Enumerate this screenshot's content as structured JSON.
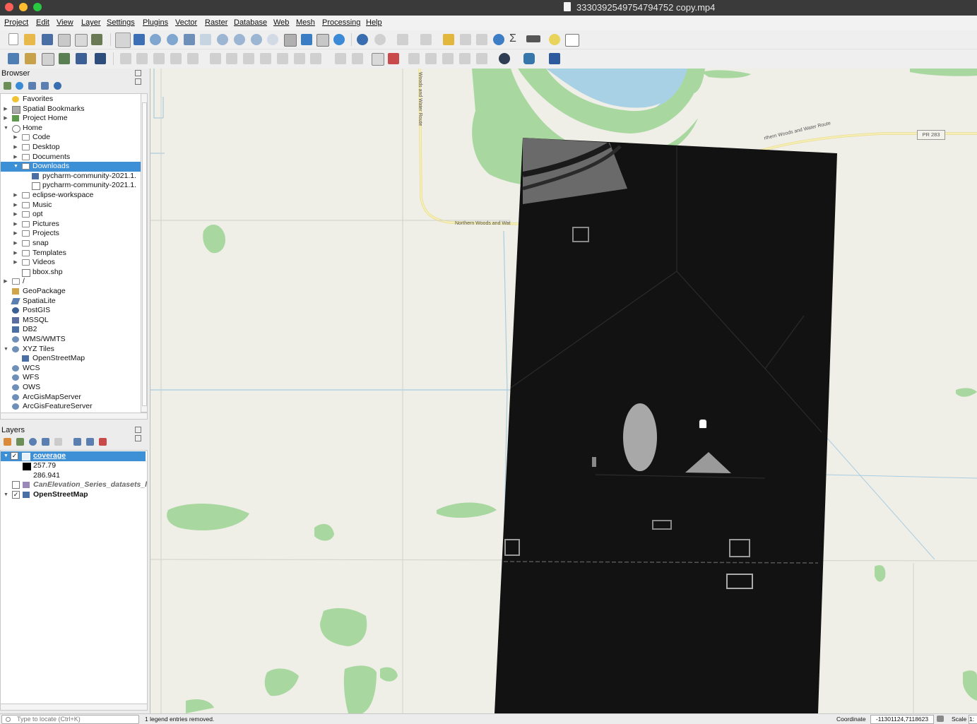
{
  "window": {
    "title": "3330392549754794752 copy.mp4"
  },
  "menubar": [
    "Project",
    "Edit",
    "View",
    "Layer",
    "Settings",
    "Plugins",
    "Vector",
    "Raster",
    "Database",
    "Web",
    "Mesh",
    "Processing",
    "Help"
  ],
  "browser": {
    "title": "Browser",
    "items": [
      {
        "label": "Favorites",
        "icon": "star-icon",
        "level": 0,
        "arrow": ""
      },
      {
        "label": "Spatial Bookmarks",
        "icon": "bookmarks-icon",
        "level": 0,
        "arrow": "right"
      },
      {
        "label": "Project Home",
        "icon": "project-home-icon",
        "level": 0,
        "arrow": "right"
      },
      {
        "label": "Home",
        "icon": "home-icon",
        "level": 0,
        "arrow": "down"
      },
      {
        "label": "Code",
        "icon": "folder-icon",
        "level": 1,
        "arrow": "right"
      },
      {
        "label": "Desktop",
        "icon": "folder-icon",
        "level": 1,
        "arrow": "right"
      },
      {
        "label": "Documents",
        "icon": "folder-icon",
        "level": 1,
        "arrow": "right"
      },
      {
        "label": "Downloads",
        "icon": "folder-icon",
        "level": 1,
        "arrow": "down",
        "selected": true
      },
      {
        "label": "pycharm-community-2021.1.",
        "icon": "xyz-tile-icon",
        "level": 2,
        "arrow": ""
      },
      {
        "label": "pycharm-community-2021.1.",
        "icon": "vector-layer-icon",
        "level": 2,
        "arrow": ""
      },
      {
        "label": "eclipse-workspace",
        "icon": "folder-icon",
        "level": 1,
        "arrow": "right"
      },
      {
        "label": "Music",
        "icon": "folder-icon",
        "level": 1,
        "arrow": "right"
      },
      {
        "label": "opt",
        "icon": "folder-icon",
        "level": 1,
        "arrow": "right"
      },
      {
        "label": "Pictures",
        "icon": "folder-icon",
        "level": 1,
        "arrow": "right"
      },
      {
        "label": "Projects",
        "icon": "folder-icon",
        "level": 1,
        "arrow": "right"
      },
      {
        "label": "snap",
        "icon": "folder-icon",
        "level": 1,
        "arrow": "right"
      },
      {
        "label": "Templates",
        "icon": "folder-icon",
        "level": 1,
        "arrow": "right"
      },
      {
        "label": "Videos",
        "icon": "folder-icon",
        "level": 1,
        "arrow": "right"
      },
      {
        "label": "bbox.shp",
        "icon": "vector-layer-icon",
        "level": 1,
        "arrow": ""
      },
      {
        "label": "/",
        "icon": "folder-icon",
        "level": 0,
        "arrow": "right"
      },
      {
        "label": "GeoPackage",
        "icon": "geopackage-icon",
        "level": 0,
        "arrow": ""
      },
      {
        "label": "SpatiaLite",
        "icon": "spatialite-icon",
        "level": 0,
        "arrow": ""
      },
      {
        "label": "PostGIS",
        "icon": "postgis-icon",
        "level": 0,
        "arrow": ""
      },
      {
        "label": "MSSQL",
        "icon": "mssql-icon",
        "level": 0,
        "arrow": ""
      },
      {
        "label": "DB2",
        "icon": "db2-icon",
        "level": 0,
        "arrow": ""
      },
      {
        "label": "WMS/WMTS",
        "icon": "globe-icon",
        "level": 0,
        "arrow": ""
      },
      {
        "label": "XYZ Tiles",
        "icon": "globe-icon",
        "level": 0,
        "arrow": "down"
      },
      {
        "label": "OpenStreetMap",
        "icon": "xyz-tile-icon",
        "level": 1,
        "arrow": ""
      },
      {
        "label": "WCS",
        "icon": "globe-icon",
        "level": 0,
        "arrow": ""
      },
      {
        "label": "WFS",
        "icon": "globe-icon",
        "level": 0,
        "arrow": ""
      },
      {
        "label": "OWS",
        "icon": "globe-icon",
        "level": 0,
        "arrow": ""
      },
      {
        "label": "ArcGisMapServer",
        "icon": "globe-icon",
        "level": 0,
        "arrow": ""
      },
      {
        "label": "ArcGisFeatureServer",
        "icon": "globe-icon",
        "level": 0,
        "arrow": ""
      }
    ]
  },
  "layers": {
    "title": "Layers",
    "coverage": {
      "name": "coverage",
      "checked": true,
      "legend_max": "257.79",
      "legend_min": "286.941"
    },
    "elevation": {
      "name": "CanElevation_Series_datasets_l",
      "checked": false
    },
    "osm": {
      "name": "OpenStreetMap",
      "checked": true
    }
  },
  "map": {
    "labels": {
      "road_vertical": "Woods and Water Route",
      "road_horizontal": "Northern Woods and Wat",
      "road_ne": "rthern Woods and Water Route",
      "highway": "PR 283"
    },
    "colors": {
      "land": "#efefe8",
      "green": "#a9d7a0",
      "water": "#a9d1e6",
      "road": "#f2e8a8",
      "raster": "#111111"
    }
  },
  "statusbar": {
    "locator_placeholder": "Type to locate (Ctrl+K)",
    "message": "1 legend entries removed.",
    "coordinate_label": "Coordinate",
    "coordinate_value": "-11301124,7118623",
    "scale_label": "Scale",
    "scale_value": "1:"
  }
}
